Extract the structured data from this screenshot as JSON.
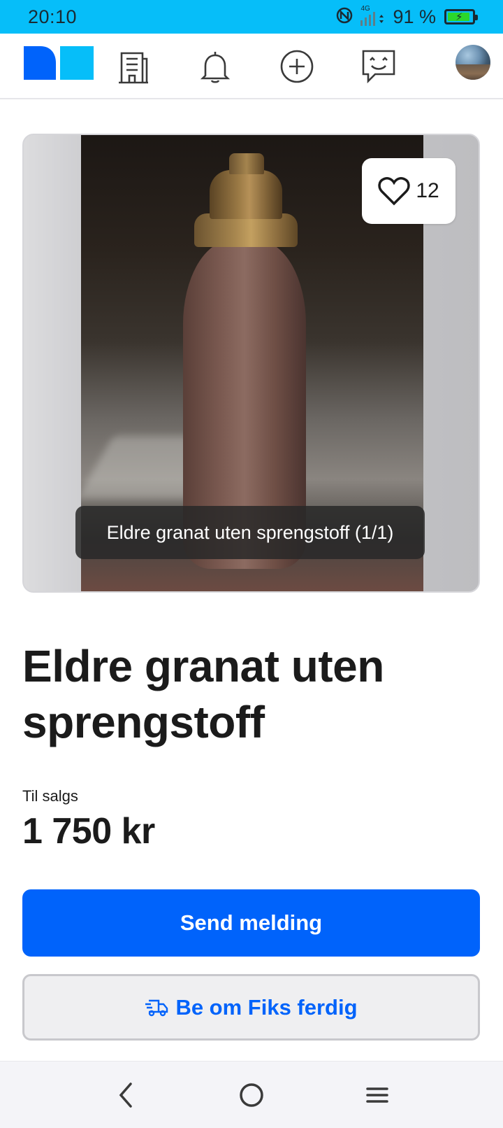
{
  "status_bar": {
    "time": "20:10",
    "network": "4G",
    "battery_percent": "91 %",
    "battery_level": 0.91,
    "battery_color": "#2bd72b"
  },
  "top_nav": {
    "logo": "finn-logo",
    "items": [
      {
        "name": "company-icon"
      },
      {
        "name": "bell-icon"
      },
      {
        "name": "plus-circle-icon"
      },
      {
        "name": "chat-icon"
      },
      {
        "name": "avatar"
      }
    ],
    "accent": "#0063fb"
  },
  "gallery": {
    "likes": "12",
    "caption": "Eldre granat uten sprengstoff (1/1)"
  },
  "listing": {
    "title": "Eldre granat uten sprengstoff",
    "status": "Til salgs",
    "price": "1 750 kr"
  },
  "actions": {
    "send_message": "Send melding",
    "fiks_ferdig": "Be om Fiks ferdig"
  },
  "system_nav": {
    "items": [
      "back-icon",
      "home-icon",
      "menu-icon"
    ]
  }
}
